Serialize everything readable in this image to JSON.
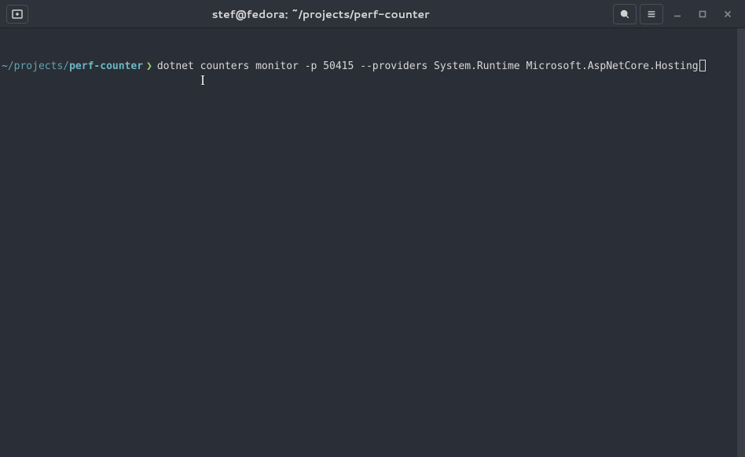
{
  "window": {
    "title": "stef@fedora: ~/projects/perf-counter"
  },
  "prompt": {
    "tilde": "~",
    "path_prefix": "/projects/",
    "path_name": "perf-counter",
    "chevron": "❯",
    "command": "dotnet counters monitor -p 50415 --providers System.Runtime Microsoft.AspNetCore.Hosting"
  },
  "icons": {
    "new_tab": "new-tab-icon",
    "search": "search-icon",
    "menu": "hamburger-icon",
    "minimize": "minimize-icon",
    "maximize": "maximize-icon",
    "close": "close-icon"
  }
}
